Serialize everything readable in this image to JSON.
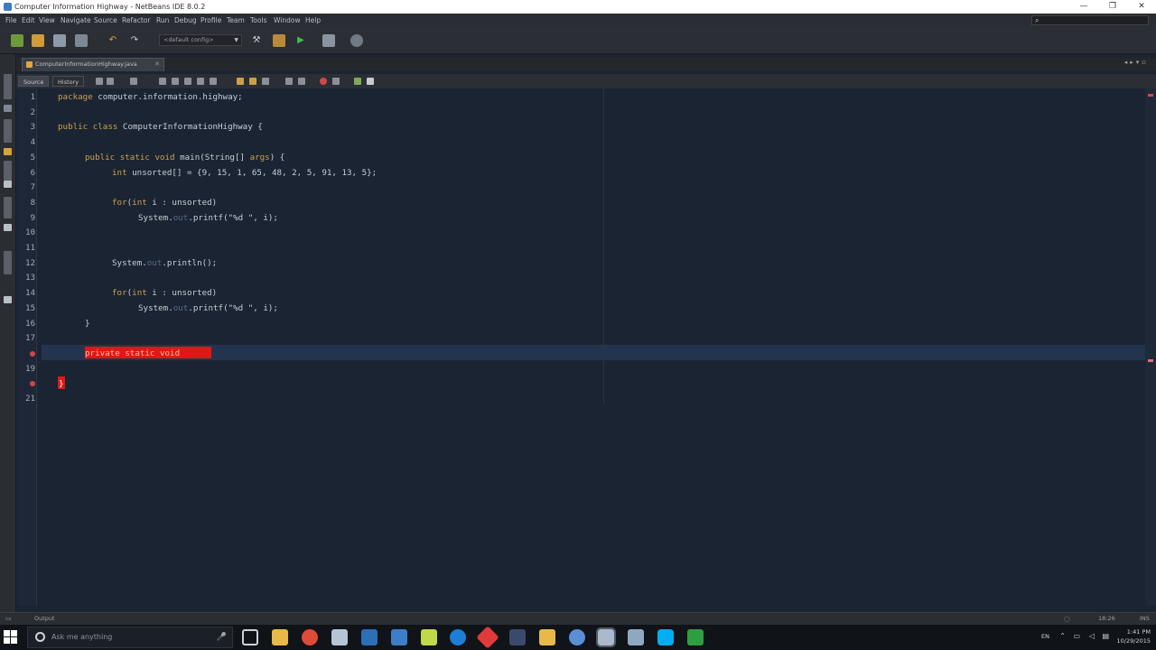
{
  "window": {
    "title": "Computer Information Highway - NetBeans IDE 8.0.2",
    "controls": [
      "—",
      "❐",
      "✕"
    ]
  },
  "menubar": {
    "items": [
      "File",
      "Edit",
      "View",
      "Navigate",
      "Source",
      "Refactor",
      "Run",
      "Debug",
      "Profile",
      "Team",
      "Tools",
      "Window",
      "Help"
    ]
  },
  "toolbar": {
    "config_value": "<default config>"
  },
  "editor": {
    "tab_label": "ComputerInformationHighway.java",
    "source_label": "Source",
    "history_label": "History",
    "line_numbers": [
      "1",
      "2",
      "3",
      "4",
      "5",
      "6",
      "7",
      "8",
      "9",
      "10",
      "11",
      "12",
      "13",
      "14",
      "15",
      "16",
      "17",
      "18",
      "19",
      "20",
      "21"
    ],
    "error_lines": [
      "18",
      "20"
    ]
  },
  "code": {
    "l1_kw": "package",
    "l1_rest": " computer.information.highway;",
    "l3_kw": "public class",
    "l3_rest": " ComputerInformationHighway {",
    "l5_kw": "public static void",
    "l5_rest": " main(String[] ",
    "l5_param": "args",
    "l5_end": ") {",
    "l6_kw": "int",
    "l6_rest": " unsorted[] = {9, 15, 1, 65, 48, 2, 5, 91, 13, 5};",
    "l8_kw": "for",
    "l8_mid": "(",
    "l8_kw2": "int",
    "l8_rest": " i : unsorted)",
    "l9_a": "System.",
    "l9_fld": "out",
    "l9_b": ".printf(\"%d \", i);",
    "l12_a": "System.",
    "l12_fld": "out",
    "l12_b": ".println();",
    "l14_kw": "for",
    "l14_mid": "(",
    "l14_kw2": "int",
    "l14_rest": " i : unsorted)",
    "l15_a": "System.",
    "l15_fld": "out",
    "l15_b": ".printf(\"%d \", i);",
    "l16": "}",
    "l18": "private static void",
    "l20": "}"
  },
  "statusbar": {
    "left": "Output",
    "position": "18:26",
    "mode": "INS"
  },
  "taskbar": {
    "search_placeholder": "Ask me anything",
    "time": "1:41 PM",
    "date": "10/29/2015",
    "lang": "EN"
  },
  "colors": {
    "editor_bg": "#1b2433",
    "keyword": "#c9a14a",
    "error": "#e01717",
    "caret_line": "#23344f"
  }
}
